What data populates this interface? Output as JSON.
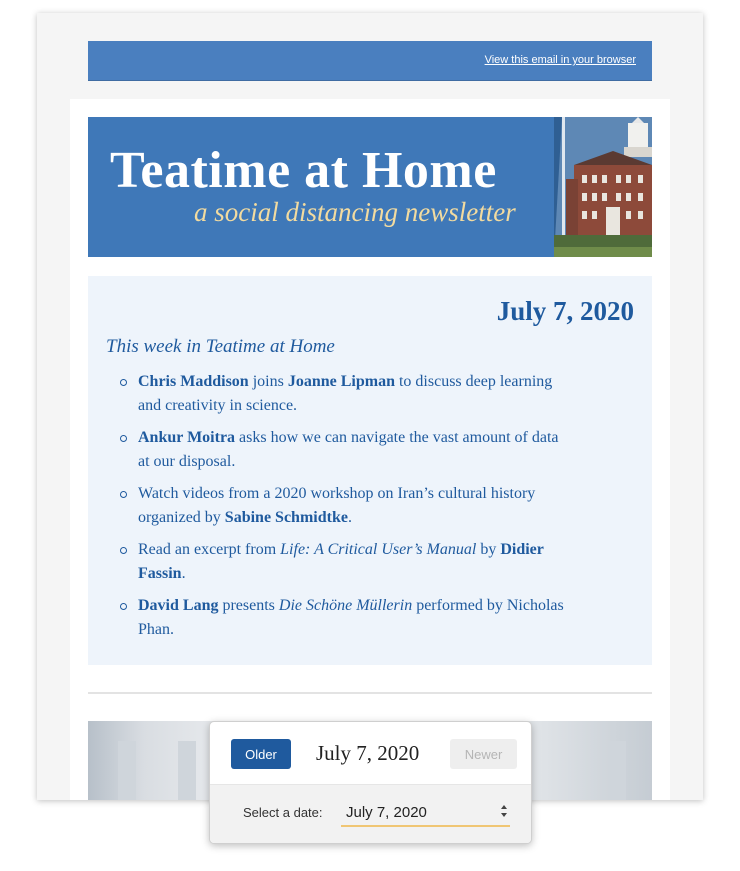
{
  "header": {
    "view_in_browser": "View this email in your browser"
  },
  "banner": {
    "title": "Teatime at Home",
    "subtitle": "a social distancing newsletter"
  },
  "issue": {
    "date": "July 7, 2020",
    "intro": "This week in Teatime at Home",
    "items": [
      {
        "s1": "Chris Maddison",
        "t1": " joins ",
        "s2": "Joanne Lipman",
        "t2": " to discuss deep learning and creativity in science."
      },
      {
        "s1": "Ankur Moitra",
        "t1": " asks how we can navigate the vast amount of data at our disposal."
      },
      {
        "t0": "Watch videos from a 2020 workshop on Iran’s cultural history organized by ",
        "s1": "Sabine Schmidtke",
        "t1": "."
      },
      {
        "t0": "Read an excerpt from ",
        "i1": "Life: A Critical User’s Manual",
        "t1": " by ",
        "s1": "Didier Fassin",
        "t2": "."
      },
      {
        "s1": "David Lang",
        "t1": " presents ",
        "i1": "Die Schöne Müllerin",
        "t2": " performed by Nicholas Phan."
      }
    ]
  },
  "nav": {
    "older": "Older",
    "date": "July 7, 2020",
    "newer": "Newer",
    "select_label": "Select a date:",
    "selected": "July 7, 2020"
  },
  "colors": {
    "accent": "#1f5a9e",
    "banner": "#3f78b8",
    "topbar": "#4a7fbf",
    "content_bg": "#eef4fb",
    "select_underline": "#f0c674"
  }
}
